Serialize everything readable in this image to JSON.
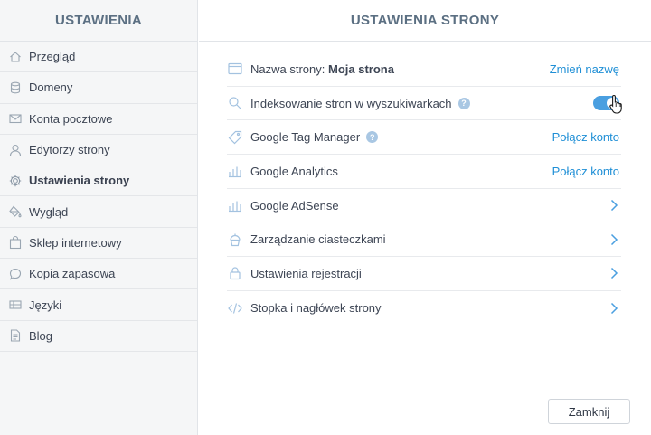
{
  "sidebar": {
    "title": "USTAWIENIA",
    "items": [
      {
        "label": "Przegląd",
        "icon": "home-icon"
      },
      {
        "label": "Domeny",
        "icon": "database-icon"
      },
      {
        "label": "Konta pocztowe",
        "icon": "mail-icon"
      },
      {
        "label": "Edytorzy strony",
        "icon": "user-icon"
      },
      {
        "label": "Ustawienia strony",
        "icon": "gear-icon",
        "active": true
      },
      {
        "label": "Wygląd",
        "icon": "paint-bucket-icon"
      },
      {
        "label": "Sklep internetowy",
        "icon": "shopping-bag-icon"
      },
      {
        "label": "Kopia zapasowa",
        "icon": "chat-bubble-icon"
      },
      {
        "label": "Języki",
        "icon": "flag-icon"
      },
      {
        "label": "Blog",
        "icon": "document-icon"
      }
    ]
  },
  "main": {
    "title": "USTAWIENIA STRONY",
    "rows": [
      {
        "label_prefix": "Nazwa strony: ",
        "label_value": "Moja strona",
        "icon": "browser-window-icon",
        "action": "Zmień nazwę"
      },
      {
        "label": "Indeksowanie stron w wyszukiwarkach",
        "icon": "search-icon",
        "help": "?",
        "toggle": true
      },
      {
        "label": "Google Tag Manager",
        "icon": "tag-icon",
        "help": "?",
        "action": "Połącz konto"
      },
      {
        "label": "Google Analytics",
        "icon": "bar-chart-icon",
        "action": "Połącz konto"
      },
      {
        "label": "Google AdSense",
        "icon": "bar-chart-icon"
      },
      {
        "label": "Zarządzanie ciasteczkami",
        "icon": "cupcake-icon"
      },
      {
        "label": "Ustawienia rejestracji",
        "icon": "lock-icon"
      },
      {
        "label": "Stopka i nagłówek strony",
        "icon": "code-icon"
      }
    ],
    "close_button": "Zamknij"
  },
  "colors": {
    "accent": "#1f8fd6",
    "toggle_on": "#4a9fe0",
    "header_text": "#5b6f82",
    "sidebar_bg": "#f5f6f7"
  }
}
